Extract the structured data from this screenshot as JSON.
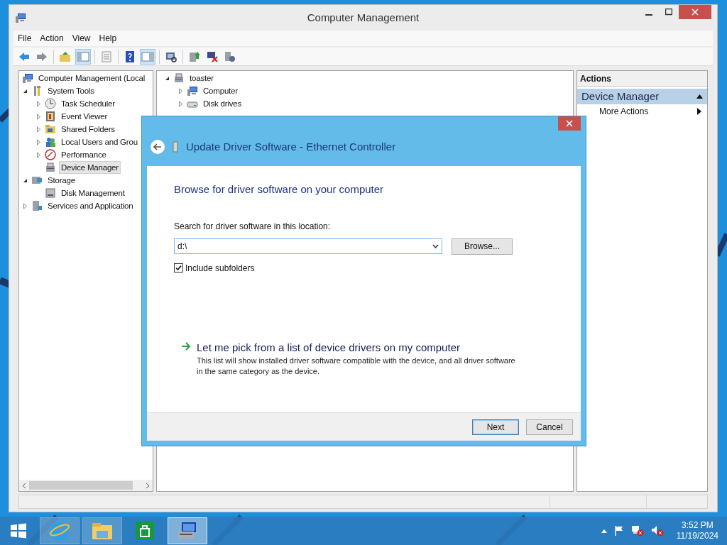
{
  "window": {
    "title": "Computer Management",
    "menu": [
      "File",
      "Action",
      "View",
      "Help"
    ],
    "toolbar": [
      {
        "kind": "back",
        "pressed": false
      },
      {
        "kind": "forward",
        "pressed": false
      },
      {
        "kind": "sep"
      },
      {
        "kind": "folder-up",
        "pressed": false
      },
      {
        "kind": "tree-pane",
        "pressed": true
      },
      {
        "kind": "sep"
      },
      {
        "kind": "properties",
        "pressed": false
      },
      {
        "kind": "sep"
      },
      {
        "kind": "help",
        "pressed": false
      },
      {
        "kind": "action-pane",
        "pressed": true
      },
      {
        "kind": "sep"
      },
      {
        "kind": "scan",
        "pressed": false
      },
      {
        "kind": "sep"
      },
      {
        "kind": "update",
        "pressed": false
      },
      {
        "kind": "uninstall",
        "pressed": false
      },
      {
        "kind": "enable",
        "pressed": false
      }
    ]
  },
  "console_tree": [
    {
      "label": "Computer Management (Local",
      "kind": "computer",
      "selected": false,
      "children": [
        {
          "label": "System Tools",
          "kind": "tools",
          "expanded": true,
          "selected": false,
          "children": [
            {
              "label": "Task Scheduler",
              "kind": "clock",
              "expanded": false,
              "selected": false
            },
            {
              "label": "Event Viewer",
              "kind": "event",
              "expanded": false,
              "selected": false
            },
            {
              "label": "Shared Folders",
              "kind": "share",
              "expanded": false,
              "selected": false
            },
            {
              "label": "Local Users and Grou",
              "kind": "users",
              "expanded": false,
              "selected": false
            },
            {
              "label": "Performance",
              "kind": "performance",
              "expanded": false,
              "selected": false
            },
            {
              "label": "Device Manager",
              "kind": "devices",
              "selected": true
            }
          ]
        },
        {
          "label": "Storage",
          "kind": "storage",
          "expanded": true,
          "selected": false,
          "children": [
            {
              "label": "Disk Management",
              "kind": "disk",
              "selected": false
            }
          ]
        },
        {
          "label": "Services and Application",
          "kind": "services",
          "expanded": false,
          "selected": false
        }
      ]
    }
  ],
  "device_tree": [
    {
      "label": "toaster",
      "kind": "devices",
      "expanded": true,
      "selected": false,
      "children": [
        {
          "label": "Computer",
          "kind": "computer",
          "expanded": false,
          "selected": false
        },
        {
          "label": "Disk drives",
          "kind": "drive",
          "expanded": false,
          "selected": false
        }
      ]
    }
  ],
  "actions": {
    "title": "Actions",
    "section": "Device Manager",
    "items": [
      "More Actions"
    ]
  },
  "dialog": {
    "title": "Update Driver Software - Ethernet Controller",
    "heading": "Browse for driver software on your computer",
    "location_label": "Search for driver software in this location:",
    "location_value": "d:\\",
    "browse": "Browse...",
    "include_subfolders": {
      "label": "Include subfolders",
      "checked": true
    },
    "pick_link": {
      "title": "Let me pick from a list of device drivers on my computer",
      "description": "This list will show installed driver software compatible with the device, and all driver software in the same category as the device."
    },
    "buttons": [
      {
        "label": "Next",
        "default": true
      },
      {
        "label": "Cancel",
        "default": false
      }
    ]
  },
  "taskbar": {
    "apps": [
      {
        "kind": "browser",
        "running": true,
        "selected": false
      },
      {
        "kind": "files",
        "running": true,
        "selected": false
      },
      {
        "kind": "store",
        "running": false,
        "selected": false
      },
      {
        "kind": "management",
        "running": true,
        "selected": true
      }
    ],
    "time": "3:52 PM",
    "date": "11/19/2024"
  }
}
